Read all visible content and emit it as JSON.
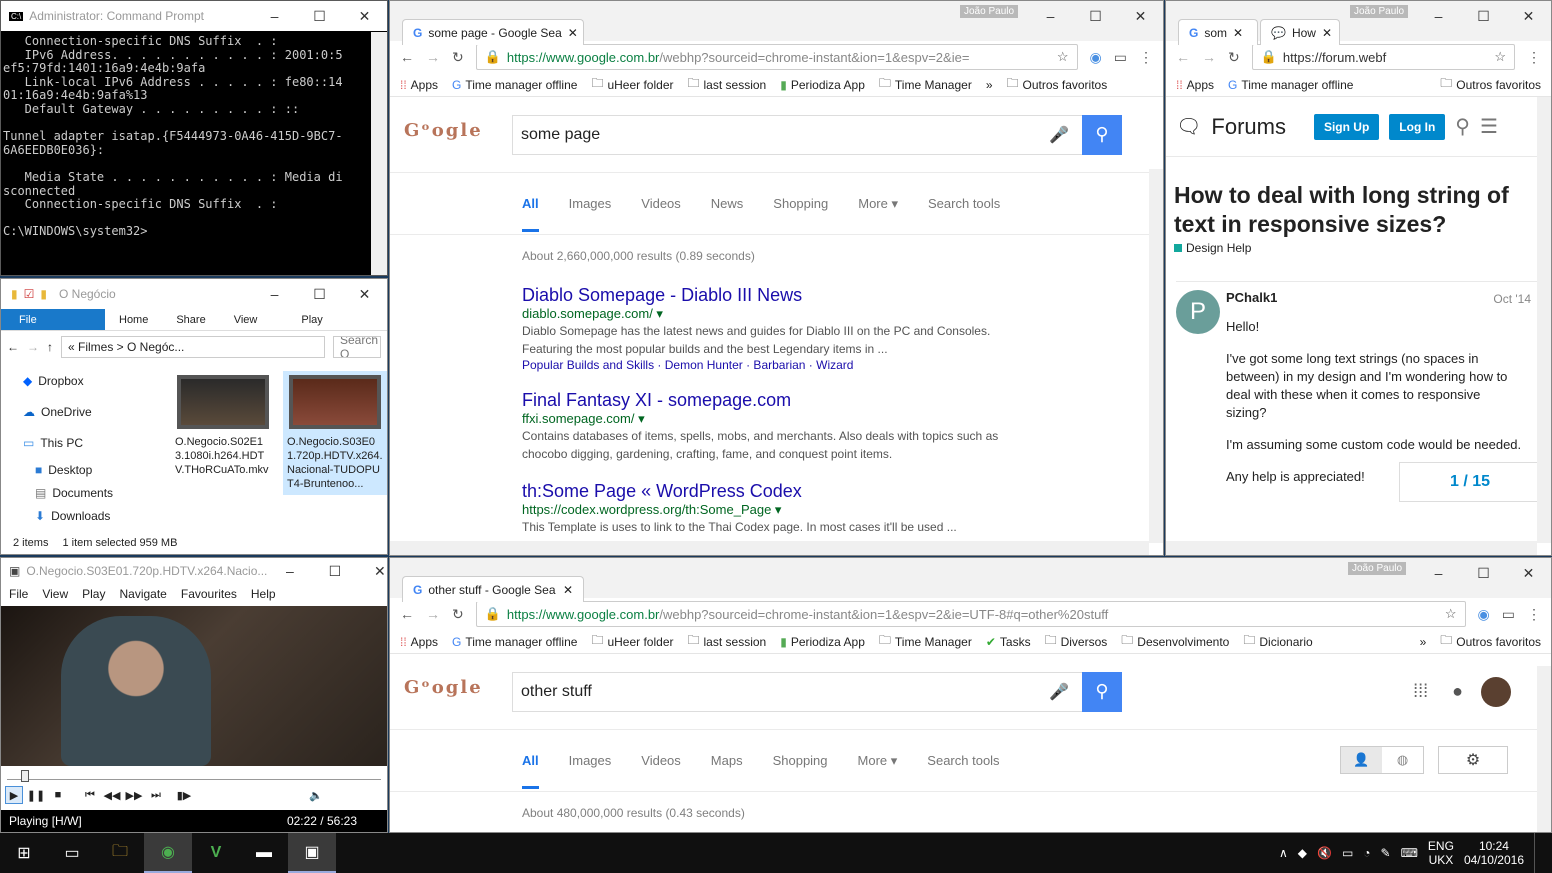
{
  "cmd": {
    "title": "Administrator: Command Prompt",
    "lines": "   Connection-specific DNS Suffix  . :\n   IPv6 Address. . . . . . . . . . . : 2001:0:5\nef5:79fd:1401:16a9:4e4b:9afa\n   Link-local IPv6 Address . . . . . : fe80::14\n01:16a9:4e4b:9afa%13\n   Default Gateway . . . . . . . . . : ::\n\nTunnel adapter isatap.{F5444973-0A46-415D-9BC7-\n6A6EEDB0E036}:\n\n   Media State . . . . . . . . . . . : Media di\nsconnected\n   Connection-specific DNS Suffix  . :\n\nC:\\WINDOWS\\system32>"
  },
  "explorer": {
    "title": "O Negócio",
    "ribbon": [
      "File",
      "Home",
      "Share",
      "View",
      "Play"
    ],
    "breadcrumb": "« Filmes > O Negóc...",
    "search": "Search O",
    "nav": [
      "Dropbox",
      "OneDrive",
      "This PC",
      "Desktop",
      "Documents",
      "Downloads"
    ],
    "files": [
      {
        "name": "O.Negocio.S02E13.1080i.h264.HDTV.THoRCuATo.mkv"
      },
      {
        "name": "O.Negocio.S03E01.720p.HDTV.x264.Nacional-TUDOPUT4-Bruntenoo..."
      }
    ],
    "items": "2 items",
    "selected": "1 item selected  959 MB"
  },
  "player": {
    "title": "O.Negocio.S03E01.720p.HDTV.x264.Nacio...",
    "menu": [
      "File",
      "View",
      "Play",
      "Navigate",
      "Favourites",
      "Help"
    ],
    "status": "Playing [H/W]",
    "time": "02:22 / 56:23"
  },
  "chrome1": {
    "tab": "some page - Google Sea",
    "badge": "João Paulo",
    "url_host": "https://www.google.com.br",
    "url_path": "/webhp?sourceid=chrome-instant&ion=1&espv=2&ie=",
    "bookmarks": [
      "Apps",
      "Time manager offline",
      "uHeer folder",
      "last session",
      "Periodiza App",
      "Time Manager"
    ],
    "other": "Outros favoritos",
    "query": "some page",
    "tabs": [
      "All",
      "Images",
      "Videos",
      "News",
      "Shopping",
      "More ▾",
      "Search tools"
    ],
    "stats": "About 2,660,000,000 results (0.89 seconds)",
    "results": [
      {
        "title": "Diablo Somepage - Diablo III News",
        "url": "diablo.somepage.com/ ▾",
        "snippet": "Diablo Somepage has the latest news and guides for Diablo III on the PC and Consoles. Featuring the most popular builds and the best Legendary items in ...",
        "links": "Popular Builds and Skills · Demon Hunter · Barbarian · Wizard"
      },
      {
        "title": "Final Fantasy XI - somepage.com",
        "url": "ffxi.somepage.com/ ▾",
        "snippet": "Contains databases of items, spells, mobs, and merchants. Also deals with topics such as chocobo digging, gardening, crafting, fame, and conquest point items.",
        "links": ""
      },
      {
        "title": "th:Some Page « WordPress Codex",
        "url": "https://codex.wordpress.org/th:Some_Page ▾",
        "snippet": "This Template is uses to link to the Thai Codex page. In most cases it'll be used ...",
        "links": ""
      }
    ]
  },
  "chrome2": {
    "tab1": "som",
    "tab2": "How",
    "badge": "João Paulo",
    "url": "https://forum.webf",
    "bookmarks": [
      "Apps",
      "Time manager offline"
    ],
    "other": "Outros favoritos",
    "logo": "Forums",
    "signup": "Sign Up",
    "login": "Log In",
    "topic": "How to deal with long string of text in responsive sizes?",
    "category": "Design Help",
    "user": "PChalk1",
    "date": "Oct '14",
    "avatar": "P",
    "post": [
      "Hello!",
      "I've got some long text strings (no spaces in between) in my design and I'm wondering how to deal with these when it comes to responsive sizing?",
      "I'm assuming some custom code would be needed.",
      "Any help is appreciated!"
    ],
    "pager": "1 / 15"
  },
  "chrome3": {
    "tab": "other stuff - Google Sea",
    "badge": "João Paulo",
    "url_host": "https://www.google.com.br",
    "url_path": "/webhp?sourceid=chrome-instant&ion=1&espv=2&ie=UTF-8#q=other%20stuff",
    "bookmarks": [
      "Apps",
      "Time manager offline",
      "uHeer folder",
      "last session",
      "Periodiza App",
      "Time Manager",
      "Tasks",
      "Diversos",
      "Desenvolvimento",
      "Dicionario"
    ],
    "other": "Outros favoritos",
    "query": "other stuff",
    "tabs": [
      "All",
      "Images",
      "Videos",
      "Maps",
      "Shopping",
      "More ▾",
      "Search tools"
    ],
    "stats": "About 480,000,000 results (0.43 seconds)"
  },
  "taskbar": {
    "lang": "ENG",
    "layout": "UKX",
    "time": "10:24",
    "date": "04/10/2016"
  }
}
